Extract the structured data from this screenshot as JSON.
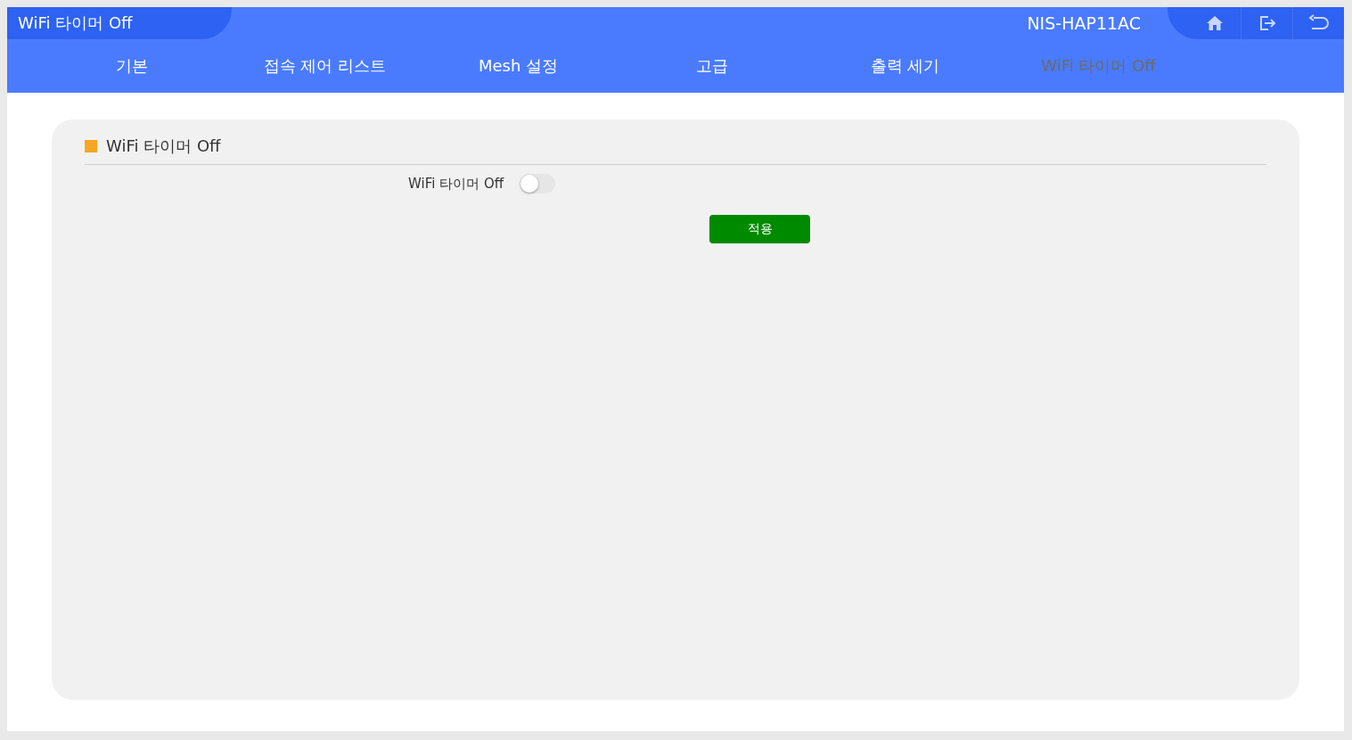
{
  "header": {
    "title": "WiFi 타이머 Off",
    "device": "NIS-HAP11AC"
  },
  "tabs": [
    {
      "label": "기본",
      "selected": false
    },
    {
      "label": "접속 제어 리스트",
      "selected": false
    },
    {
      "label": "Mesh 설정",
      "selected": false
    },
    {
      "label": "고급",
      "selected": false
    },
    {
      "label": "출력 세기",
      "selected": false
    },
    {
      "label": "WiFi 타이머 Off",
      "selected": true
    }
  ],
  "section": {
    "title": "WiFi 타이머 Off",
    "setting": {
      "label": "WiFi 타이머 Off",
      "on": false
    },
    "apply_button": "적용"
  }
}
